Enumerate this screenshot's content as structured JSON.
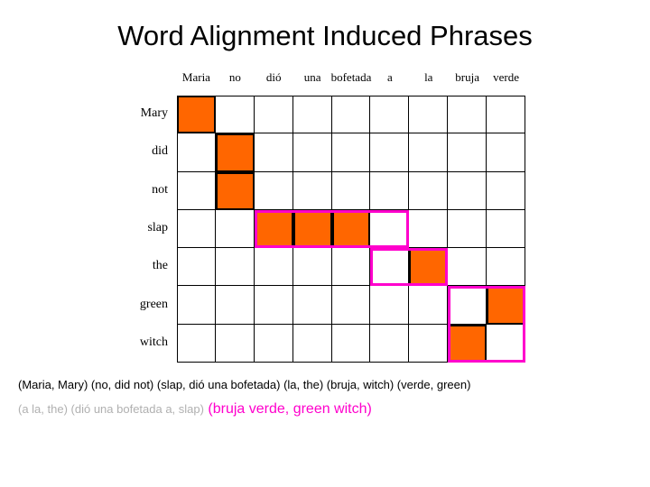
{
  "title": "Word Alignment Induced Phrases",
  "grid": {
    "columns": [
      "Maria",
      "no",
      "dió",
      "una",
      "bofetada",
      "a",
      "la",
      "bruja",
      "verde"
    ],
    "rows": [
      "Mary",
      "did",
      "not",
      "slap",
      "the",
      "green",
      "witch"
    ],
    "alignments": [
      {
        "row": 0,
        "col": 0
      },
      {
        "row": 1,
        "col": 1
      },
      {
        "row": 2,
        "col": 1
      },
      {
        "row": 3,
        "col": 2
      },
      {
        "row": 3,
        "col": 3
      },
      {
        "row": 3,
        "col": 4
      },
      {
        "row": 4,
        "col": 6
      },
      {
        "row": 5,
        "col": 8
      },
      {
        "row": 6,
        "col": 7
      }
    ],
    "phrase_boxes": [
      {
        "row_start": 3,
        "row_end": 3,
        "col_start": 2,
        "col_end": 5
      },
      {
        "row_start": 4,
        "row_end": 4,
        "col_start": 5,
        "col_end": 6
      },
      {
        "row_start": 5,
        "row_end": 6,
        "col_start": 7,
        "col_end": 8
      }
    ],
    "colors": {
      "alignment_fill": "#ff6600",
      "alignment_border": "#000000",
      "phrase_box": "#ff00cc",
      "grid_line": "#000000"
    }
  },
  "captions": {
    "line1": "(Maria, Mary) (no, did not) (slap, dió una bofetada) (la, the) (bruja, witch) (verde, green)",
    "line2_gray": "(a la, the) (dió una bofetada a, slap)",
    "line2_pink": "(bruja verde, green witch)"
  }
}
